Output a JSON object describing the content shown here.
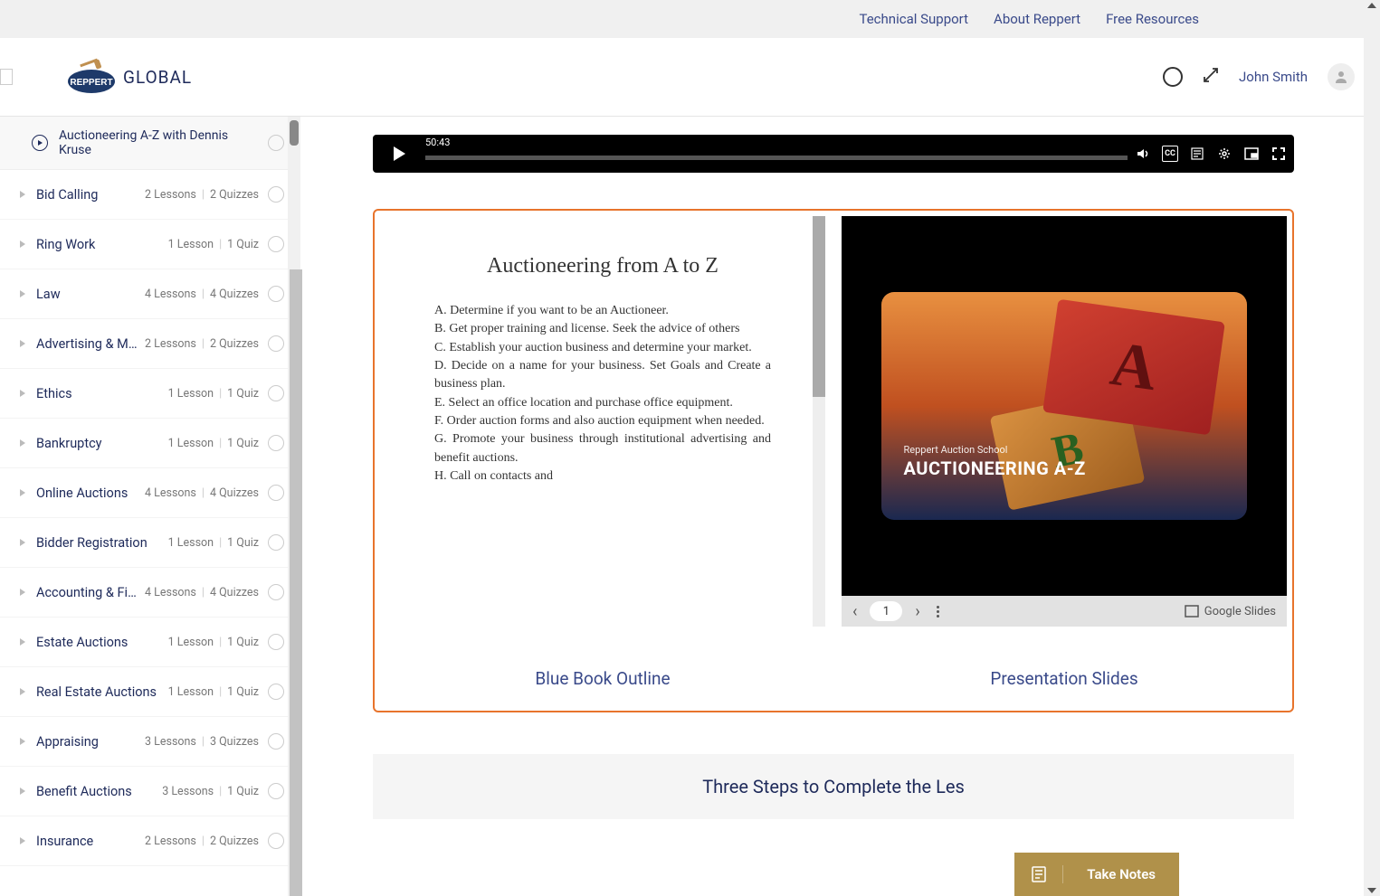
{
  "topNav": {
    "technical": "Technical Support",
    "about": "About Reppert",
    "free": "Free Resources"
  },
  "header": {
    "logoText": "GLOBAL",
    "userName": "John Smith"
  },
  "currentLesson": "Auctioneering A-Z with Dennis Kruse",
  "sections": [
    {
      "title": "Bid Calling",
      "lessons": "2 Lessons",
      "quizzes": "2 Quizzes"
    },
    {
      "title": "Ring Work",
      "lessons": "1 Lesson",
      "quizzes": "1 Quiz"
    },
    {
      "title": "Law",
      "lessons": "4 Lessons",
      "quizzes": "4 Quizzes"
    },
    {
      "title": "Advertising & Mar...",
      "lessons": "2 Lessons",
      "quizzes": "2 Quizzes"
    },
    {
      "title": "Ethics",
      "lessons": "1 Lesson",
      "quizzes": "1 Quiz"
    },
    {
      "title": "Bankruptcy",
      "lessons": "1 Lesson",
      "quizzes": "1 Quiz"
    },
    {
      "title": "Online Auctions",
      "lessons": "4 Lessons",
      "quizzes": "4 Quizzes"
    },
    {
      "title": "Bidder Registration",
      "lessons": "1 Lesson",
      "quizzes": "1 Quiz"
    },
    {
      "title": "Accounting & Fina...",
      "lessons": "4 Lessons",
      "quizzes": "4 Quizzes"
    },
    {
      "title": "Estate Auctions",
      "lessons": "1 Lesson",
      "quizzes": "1 Quiz"
    },
    {
      "title": "Real Estate Auctions",
      "lessons": "1 Lesson",
      "quizzes": "1 Quiz"
    },
    {
      "title": "Appraising",
      "lessons": "3 Lessons",
      "quizzes": "3 Quizzes"
    },
    {
      "title": "Benefit Auctions",
      "lessons": "3 Lessons",
      "quizzes": "1 Quiz"
    },
    {
      "title": "Insurance",
      "lessons": "2 Lessons",
      "quizzes": "2 Quizzes"
    }
  ],
  "video": {
    "time": "50:43"
  },
  "book": {
    "title": "Auctioneering from A to Z",
    "body": "A.      Determine if you want to be an Auctioneer.\nB.      Get proper training and license.  Seek the advice of others\nC.      Establish your auction business and determine your market.\nD.      Decide on a name for your business.  Set Goals and Create a business plan.\nE.      Select an office location and purchase office equipment.\nF.      Order auction forms and also auction equipment when needed.\nG.      Promote your business through institutional advertising and benefit auctions.\nH.      Call on contacts and"
  },
  "slide": {
    "school": "Reppert Auction School",
    "title": "AUCTIONEERING A-Z",
    "page": "1",
    "provider": "Google Slides"
  },
  "labels": {
    "blueBook": "Blue Book Outline",
    "presentation": "Presentation Slides"
  },
  "nextSection": "Three Steps to Complete the Les",
  "notesBtn": "Take Notes"
}
